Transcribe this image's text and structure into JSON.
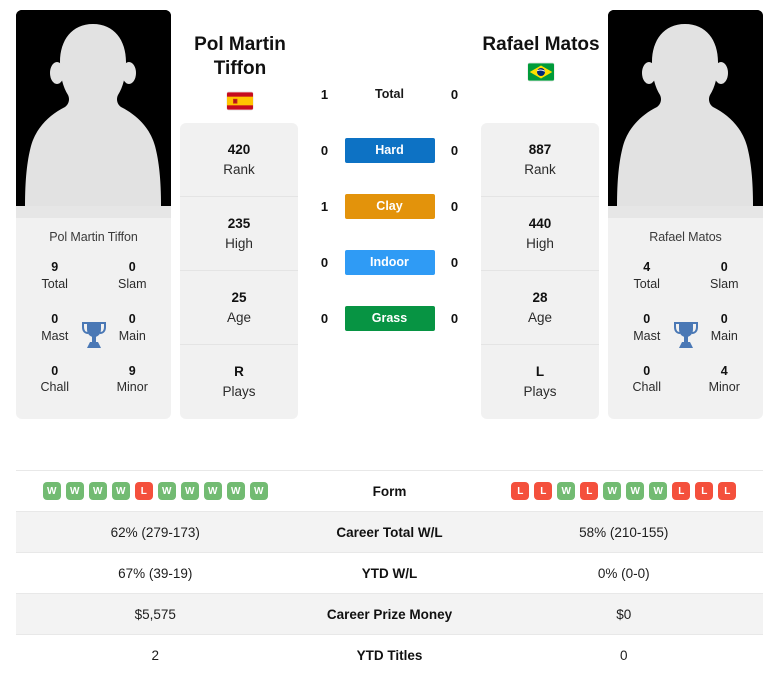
{
  "colors": {
    "hard": "#0d72c4",
    "clay": "#e3930b",
    "indoor": "#2f9bf5",
    "grass": "#079443",
    "win": "#72bb72",
    "loss": "#f4503c",
    "trophy": "#4a78b5",
    "card_bg": "#f1f1f1",
    "row_shade": "#f3f3f3"
  },
  "left_player": {
    "headline_name": "Pol Martin\nTiffon",
    "headline_name_line1": "Pol Martin",
    "headline_name_line2": "Tiffon",
    "caption_name": "Pol Martin Tiffon",
    "flag": "spain-flag",
    "photo": "player-photo-placeholder",
    "titles": [
      {
        "value": "9",
        "label": "Total"
      },
      {
        "value": "0",
        "label": "Slam"
      },
      {
        "value": "0",
        "label": "Mast"
      },
      {
        "value": "0",
        "label": "Main"
      },
      {
        "value": "0",
        "label": "Chall"
      },
      {
        "value": "9",
        "label": "Minor"
      }
    ],
    "stats": [
      {
        "value": "420",
        "label": "Rank"
      },
      {
        "value": "235",
        "label": "High"
      },
      {
        "value": "25",
        "label": "Age"
      },
      {
        "value": "R",
        "label": "Plays"
      }
    ],
    "surface_counts": {
      "total": "1",
      "hard": "0",
      "clay": "1",
      "indoor": "0",
      "grass": "0"
    },
    "form": [
      "W",
      "W",
      "W",
      "W",
      "L",
      "W",
      "W",
      "W",
      "W",
      "W"
    ],
    "career_total_wl": "62% (279-173)",
    "ytd_wl": "67% (39-19)",
    "career_prize_money": "$5,575",
    "ytd_titles": "2"
  },
  "right_player": {
    "headline_name": "Rafael Matos",
    "headline_name_line1": "Rafael Matos",
    "headline_name_line2": "",
    "caption_name": "Rafael Matos",
    "flag": "brazil-flag",
    "photo": "player-photo-placeholder",
    "titles": [
      {
        "value": "4",
        "label": "Total"
      },
      {
        "value": "0",
        "label": "Slam"
      },
      {
        "value": "0",
        "label": "Mast"
      },
      {
        "value": "0",
        "label": "Main"
      },
      {
        "value": "0",
        "label": "Chall"
      },
      {
        "value": "4",
        "label": "Minor"
      }
    ],
    "stats": [
      {
        "value": "887",
        "label": "Rank"
      },
      {
        "value": "440",
        "label": "High"
      },
      {
        "value": "28",
        "label": "Age"
      },
      {
        "value": "L",
        "label": "Plays"
      }
    ],
    "surface_counts": {
      "total": "0",
      "hard": "0",
      "clay": "0",
      "indoor": "0",
      "grass": "0"
    },
    "form": [
      "L",
      "L",
      "W",
      "L",
      "W",
      "W",
      "W",
      "L",
      "L",
      "L"
    ],
    "career_total_wl": "58% (210-155)",
    "ytd_wl": "0% (0-0)",
    "career_prize_money": "$0",
    "ytd_titles": "0"
  },
  "surfaces": [
    {
      "key": "total",
      "label": "Total",
      "style": "plain"
    },
    {
      "key": "hard",
      "label": "Hard",
      "style": "hard"
    },
    {
      "key": "clay",
      "label": "Clay",
      "style": "clay"
    },
    {
      "key": "indoor",
      "label": "Indoor",
      "style": "indoor"
    },
    {
      "key": "grass",
      "label": "Grass",
      "style": "grass"
    }
  ],
  "table_rows": [
    {
      "key": "form",
      "label": "Form"
    },
    {
      "key": "career_total_wl",
      "label": "Career Total W/L"
    },
    {
      "key": "ytd_wl",
      "label": "YTD W/L"
    },
    {
      "key": "career_prize_money",
      "label": "Career Prize Money"
    },
    {
      "key": "ytd_titles",
      "label": "YTD Titles"
    }
  ]
}
